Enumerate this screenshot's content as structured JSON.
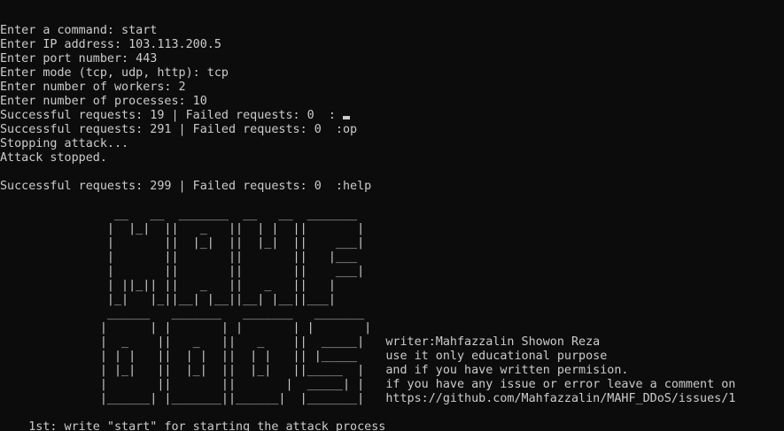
{
  "console": {
    "output": [
      "Enter a command: start",
      "Enter IP address: 103.113.200.5",
      "Enter port number: 443",
      "Enter mode (tcp, udp, http): tcp",
      "Enter number of workers: 2",
      "Enter number of processes: 10",
      "Successful requests: 19 | Failed requests: 0  :",
      "Successful requests: 291 | Failed requests: 0  :op",
      "Stopping attack...",
      "Attack stopped.",
      "",
      "Successful requests: 299 | Failed requests: 0  :help",
      "",
      "                __   __  _______  __   __  _______",
      "               |  |_|  ||   _   ||  | |  ||       |",
      "               |       ||  |_|  ||  |_|  ||    ___|",
      "               |       ||       ||       ||   |___",
      "               |       ||       ||       ||    ___|",
      "               | ||_|| ||   _   ||   _   ||   |",
      "               |_|   |_||__| |__||__| |__||___|",
      "               ______   _______   _______   _______",
      "              |      | |       | |       | |       |",
      "              |  _    ||   _   ||   _    ||  _____|   writer:Mahfazzalin Showon Reza",
      "              | | |   ||  | |  ||  | |   || |_____    use it only educational purpose",
      "              | |_|   ||  |_|  ||  |_|   ||_____  |   and if you have written permision.",
      "              |       ||       ||       |  _____| |   if you have any issue or error leave a comment on",
      "              |______| |_______||______|  |_______|   https://github.com/Mahfazzalin/MAHF_DDoS/issues/1",
      "",
      "    1st: write \"start\" for starting the attack process"
    ]
  }
}
